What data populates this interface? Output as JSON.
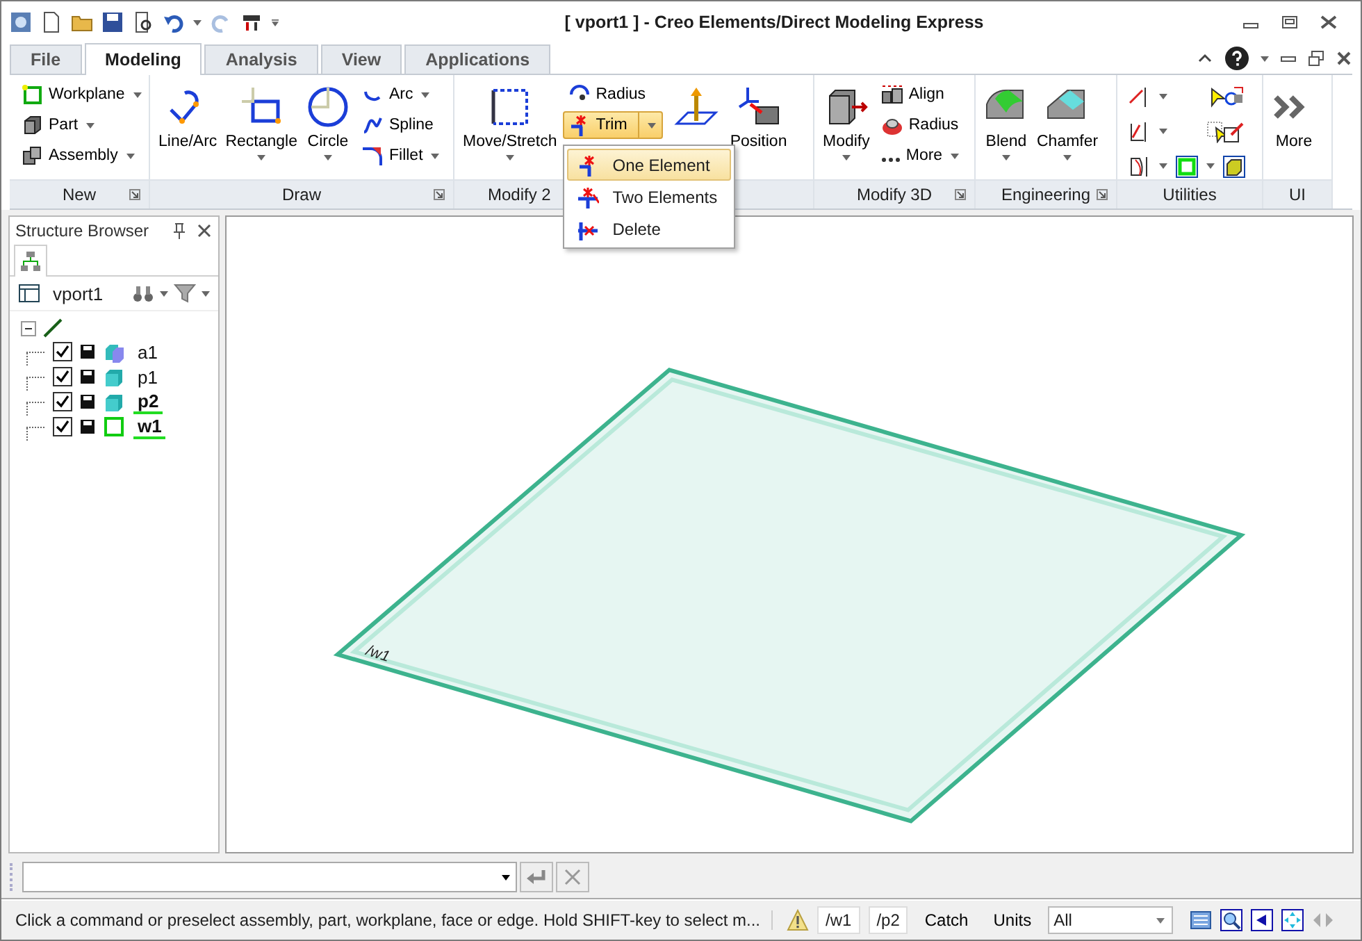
{
  "window": {
    "title": "[ vport1 ] - Creo Elements/Direct Modeling Express"
  },
  "tabs": [
    {
      "label": "File",
      "selected": false
    },
    {
      "label": "Modeling",
      "selected": true
    },
    {
      "label": "Analysis",
      "selected": false
    },
    {
      "label": "View",
      "selected": false
    },
    {
      "label": "Applications",
      "selected": false
    }
  ],
  "ribbon": {
    "groups": [
      {
        "label": "New",
        "items": [
          {
            "label": "Workplane"
          },
          {
            "label": "Part"
          },
          {
            "label": "Assembly"
          }
        ]
      },
      {
        "label": "Draw",
        "items": [
          {
            "label": "Line/Arc"
          },
          {
            "label": "Rectangle"
          },
          {
            "label": "Circle"
          },
          {
            "label": "Arc"
          },
          {
            "label": "Spline"
          },
          {
            "label": "Fillet"
          }
        ]
      },
      {
        "label": "Modify 2",
        "items": [
          {
            "label": "Move/Stretch"
          },
          {
            "label": "Radius"
          },
          {
            "label": "Trim",
            "selected": true,
            "expanded": true
          },
          {
            "label": "Position"
          }
        ]
      },
      {
        "label": "Modify 3D",
        "items": [
          {
            "label": "Modify"
          },
          {
            "label": "Align"
          },
          {
            "label": "Radius"
          },
          {
            "label": "More"
          }
        ]
      },
      {
        "label": "Engineering",
        "items": [
          {
            "label": "Blend"
          },
          {
            "label": "Chamfer"
          }
        ]
      },
      {
        "label": "Utilities"
      },
      {
        "label": "UI",
        "items": [
          {
            "label": "More"
          }
        ]
      }
    ]
  },
  "trim_menu": [
    {
      "label": "One Element",
      "selected": true
    },
    {
      "label": "Two Elements",
      "selected": false
    },
    {
      "label": "Delete",
      "selected": false
    }
  ],
  "structure_browser": {
    "title": "Structure Browser",
    "viewport": "vport1",
    "tree": [
      {
        "expanded": true,
        "children": [
          {
            "label": "a1",
            "kind": "assembly",
            "checked": true,
            "active": false
          },
          {
            "label": "p1",
            "kind": "part",
            "checked": true,
            "active": false
          },
          {
            "label": "p2",
            "kind": "part",
            "checked": true,
            "active": true
          },
          {
            "label": "w1",
            "kind": "workplane",
            "checked": true,
            "active": true
          }
        ]
      }
    ]
  },
  "viewport": {
    "workplane_label": "/w1"
  },
  "status_bar": {
    "message": "Click a command or preselect assembly, part, workplane, face or edge. Hold SHIFT-key to select m...",
    "workplane": "/w1",
    "part": "/p2",
    "catch": "Catch",
    "units": "Units",
    "filter": "All"
  }
}
